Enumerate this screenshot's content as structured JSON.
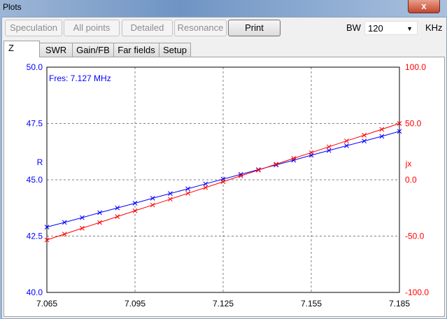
{
  "window": {
    "title": "Plots",
    "close": "x"
  },
  "toolbar": {
    "buttons": [
      "Speculation",
      "All points",
      "Detailed",
      "Resonance",
      "Print"
    ],
    "bw_label": "BW",
    "bw_value": "120",
    "bw_unit": "KHz"
  },
  "tabs": [
    "Z",
    "SWR",
    "Gain/FB",
    "Far fields",
    "Setup"
  ],
  "chart_data": {
    "type": "line",
    "annotation": "Fres: 7.127 MHz",
    "xlabel": "",
    "x_ticks": [
      "7.065",
      "7.095",
      "7.125",
      "7.155",
      "7.185"
    ],
    "xlim": [
      7.065,
      7.185
    ],
    "y_left": {
      "label": "R",
      "ticks": [
        "50.0",
        "47.5",
        "45.0",
        "42.5",
        "40.0"
      ],
      "lim": [
        40,
        50
      ]
    },
    "y_right": {
      "label": "jx",
      "ticks": [
        "100.0",
        "50.0",
        "0.0",
        "-50.0",
        "-100.0"
      ],
      "lim": [
        -100,
        100
      ]
    },
    "grid": true,
    "x": [
      7.065,
      7.071,
      7.077,
      7.083,
      7.089,
      7.095,
      7.101,
      7.107,
      7.113,
      7.119,
      7.125,
      7.131,
      7.137,
      7.143,
      7.149,
      7.155,
      7.161,
      7.167,
      7.173,
      7.179,
      7.185
    ],
    "series": [
      {
        "name": "R",
        "axis": "left",
        "color": "#0000ff",
        "values": [
          42.9,
          43.11,
          43.32,
          43.54,
          43.75,
          43.96,
          44.18,
          44.39,
          44.6,
          44.82,
          45.03,
          45.24,
          45.45,
          45.66,
          45.87,
          46.09,
          46.3,
          46.51,
          46.72,
          46.93,
          47.15
        ]
      },
      {
        "name": "jx",
        "axis": "right",
        "color": "#ff0000",
        "values": [
          -53.4,
          -48.2,
          -43.0,
          -37.9,
          -32.7,
          -27.5,
          -22.4,
          -17.2,
          -12.0,
          -6.9,
          -1.7,
          3.5,
          8.6,
          13.8,
          19.0,
          24.1,
          29.3,
          34.5,
          39.6,
          44.8,
          50.0
        ]
      }
    ]
  }
}
